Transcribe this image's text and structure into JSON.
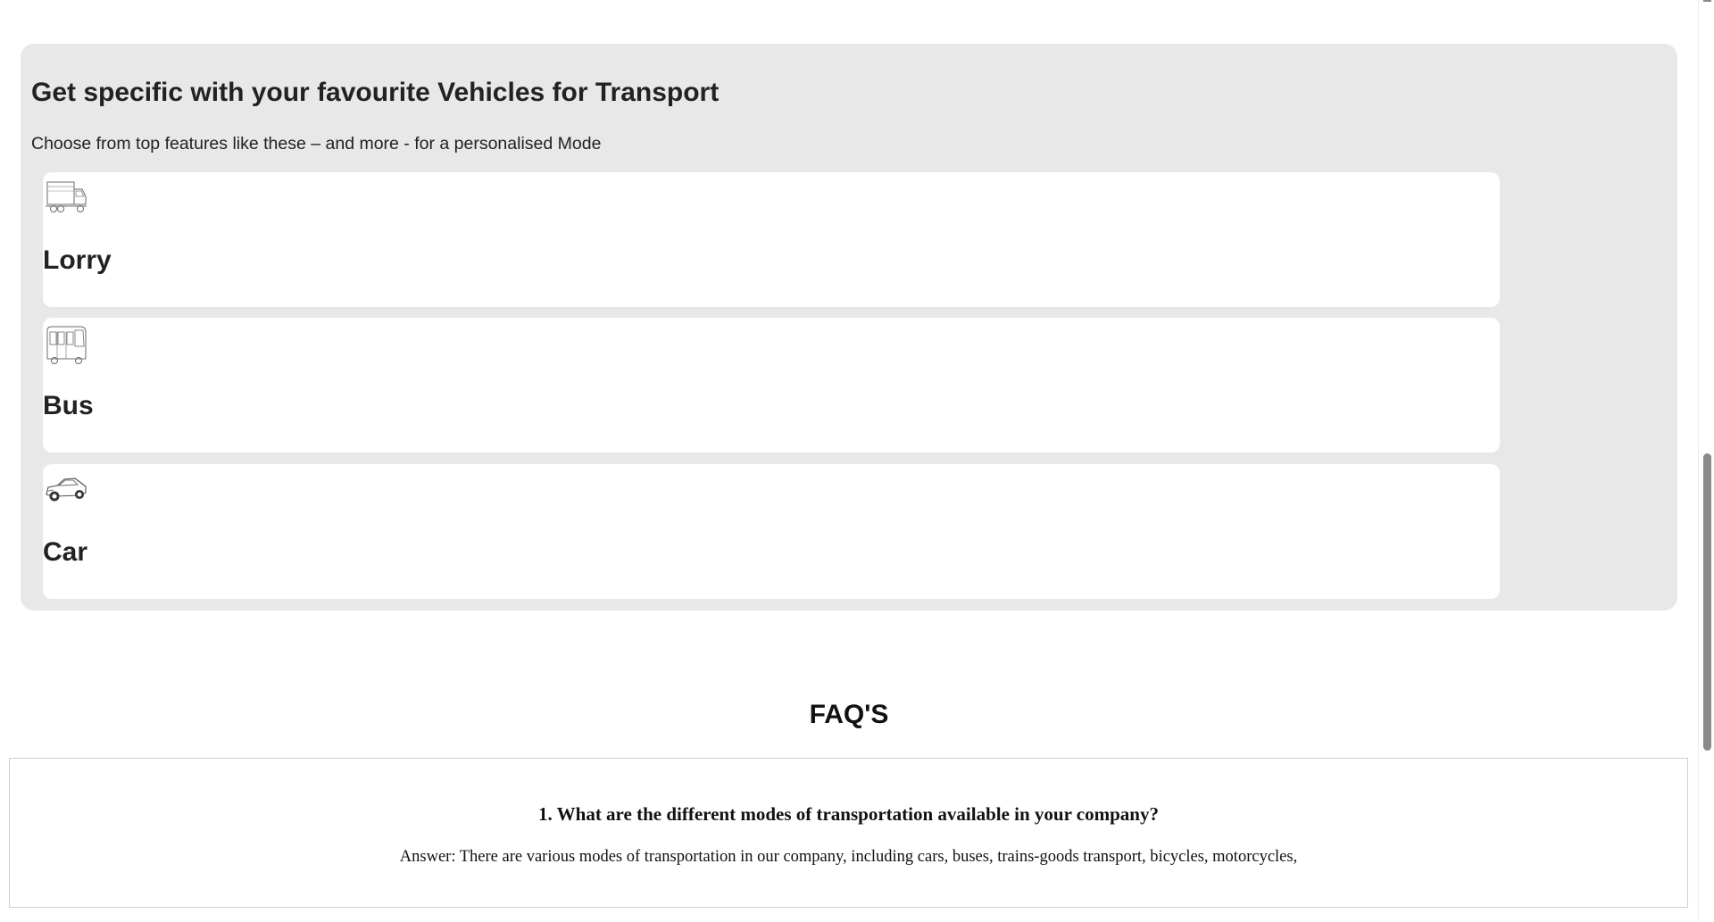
{
  "features": {
    "title": "Get specific with your favourite Vehicles for Transport",
    "subtitle": "Choose from top features like these – and more - for a personalised Mode",
    "vehicles": [
      {
        "name": "Lorry",
        "icon": "lorry-icon"
      },
      {
        "name": "Bus",
        "icon": "bus-icon"
      },
      {
        "name": "Car",
        "icon": "car-icon"
      }
    ]
  },
  "faq": {
    "heading": "FAQ'S",
    "items": [
      {
        "question": "1. What are the different modes of transportation available in your company?",
        "answer": "Answer: There are various modes of transportation in our company, including cars, buses, trains-goods transport, bicycles, motorcycles,"
      }
    ]
  },
  "colors": {
    "panel_background": "#e8e8e8",
    "card_background": "#ffffff",
    "scroll_thumb": "#8a8a8a"
  }
}
